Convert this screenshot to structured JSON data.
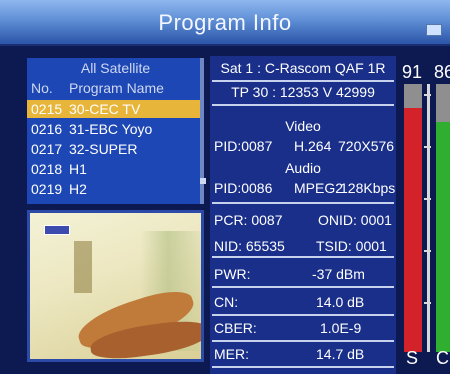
{
  "title": "Program Info",
  "title_icon": "tv-icon",
  "list": {
    "header": "All Satellite",
    "col_no": "No.",
    "col_name": "Program Name",
    "rows": [
      {
        "num": "0215",
        "name": "30-CEC TV",
        "selected": true
      },
      {
        "num": "0216",
        "name": "31-EBC Yoyo",
        "selected": false
      },
      {
        "num": "0217",
        "name": "32-SUPER",
        "selected": false
      },
      {
        "num": "0218",
        "name": "H1",
        "selected": false
      },
      {
        "num": "0219",
        "name": "H2",
        "selected": false
      }
    ]
  },
  "info": {
    "sat": "Sat 1 : C-Rascom QAF 1R",
    "tp": "TP 30 : 12353 V 42999",
    "video_label": "Video",
    "video_pid": "PID:0087",
    "video_codec": "H.264",
    "video_res": "720X576",
    "audio_label": "Audio",
    "audio_pid": "PID:0086",
    "audio_codec": "MPEG2",
    "audio_rate": "128Kbps",
    "pcr": "PCR: 0087",
    "onid": "ONID: 0001",
    "nid": "NID: 65535",
    "tsid": "TSID: 0001",
    "pwr_label": "PWR:",
    "pwr_value": "-37 dBm",
    "cn_label": "CN:",
    "cn_value": "14.0 dB",
    "cber_label": "CBER:",
    "cber_value": "1.0E-9",
    "mer_label": "MER:",
    "mer_value": "14.7 dB"
  },
  "meters": {
    "strength": {
      "value": "91",
      "label": "S",
      "fill_percent": 91,
      "color": "#d4222a"
    },
    "quality": {
      "value": "86",
      "label": "C",
      "fill_percent": 86,
      "color": "#2fae2f"
    }
  },
  "colors": {
    "selection": "#e8b53b",
    "list_bg": "#1d47b5",
    "info_bg": "#1a2f8a"
  }
}
